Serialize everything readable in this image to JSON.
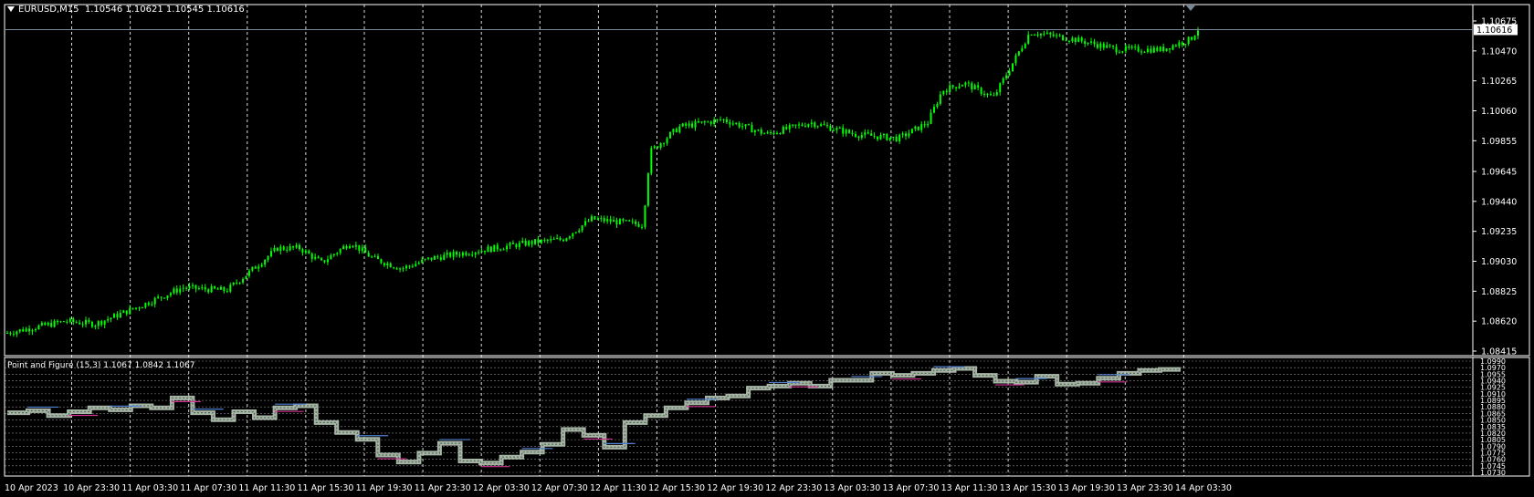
{
  "chart_title": {
    "symbol": "EURUSD,M15",
    "ohlc": "1.10546 1.10621 1.10545 1.10616"
  },
  "indicator_title": "Point and Figure (15,3) 1.1067 1.0842 1.1067",
  "current_price_label": "1.10616",
  "colors": {
    "background": "#000000",
    "candle": "#00ff00",
    "grid": "#ffffff",
    "frame": "#ffffff",
    "bid_line": "#778899",
    "pf_box": "#b8c8b8",
    "pf_blue": "#4f7fd0",
    "pf_magenta": "#d0308f",
    "price_label_bg": "#ffffff",
    "price_label_fg": "#000000"
  },
  "chart_data": [
    {
      "type": "candlestick",
      "y_ticks": [
        "1.10675",
        "1.10470",
        "1.10265",
        "1.10060",
        "1.09855",
        "1.09645",
        "1.09440",
        "1.09235",
        "1.09030",
        "1.08825",
        "1.08620",
        "1.08415"
      ],
      "ylim": [
        1.08415,
        1.10675
      ],
      "x_ticks": [
        "10 Apr 2023",
        "10 Apr 23:30",
        "11 Apr 03:30",
        "11 Apr 07:30",
        "11 Apr 11:30",
        "11 Apr 15:30",
        "11 Apr 19:30",
        "11 Apr 23:30",
        "12 Apr 03:30",
        "12 Apr 07:30",
        "12 Apr 11:30",
        "12 Apr 15:30",
        "12 Apr 19:30",
        "12 Apr 23:30",
        "13 Apr 03:30",
        "13 Apr 07:30",
        "13 Apr 11:30",
        "13 Apr 15:30",
        "13 Apr 19:30",
        "13 Apr 23:30",
        "14 Apr 03:30"
      ],
      "gridlines": "vertical-dashed",
      "close_path": [
        {
          "x": 0.0,
          "y": 1.0854
        },
        {
          "x": 0.04,
          "y": 1.0862
        },
        {
          "x": 0.06,
          "y": 1.086
        },
        {
          "x": 0.09,
          "y": 1.0872
        },
        {
          "x": 0.12,
          "y": 1.0885
        },
        {
          "x": 0.15,
          "y": 1.0883
        },
        {
          "x": 0.165,
          "y": 1.0895
        },
        {
          "x": 0.185,
          "y": 1.0912
        },
        {
          "x": 0.2,
          "y": 1.0912
        },
        {
          "x": 0.215,
          "y": 1.0902
        },
        {
          "x": 0.235,
          "y": 1.0916
        },
        {
          "x": 0.25,
          "y": 1.0905
        },
        {
          "x": 0.27,
          "y": 1.0898
        },
        {
          "x": 0.29,
          "y": 1.0905
        },
        {
          "x": 0.32,
          "y": 1.091
        },
        {
          "x": 0.36,
          "y": 1.0916
        },
        {
          "x": 0.38,
          "y": 1.0918
        },
        {
          "x": 0.4,
          "y": 1.0932
        },
        {
          "x": 0.435,
          "y": 1.0928
        },
        {
          "x": 0.44,
          "y": 1.0978
        },
        {
          "x": 0.46,
          "y": 1.0995
        },
        {
          "x": 0.49,
          "y": 1.1
        },
        {
          "x": 0.52,
          "y": 1.099
        },
        {
          "x": 0.55,
          "y": 1.0998
        },
        {
          "x": 0.58,
          "y": 1.099
        },
        {
          "x": 0.61,
          "y": 1.0987
        },
        {
          "x": 0.63,
          "y": 1.0998
        },
        {
          "x": 0.64,
          "y": 1.102
        },
        {
          "x": 0.655,
          "y": 1.1025
        },
        {
          "x": 0.675,
          "y": 1.1015
        },
        {
          "x": 0.69,
          "y": 1.1042
        },
        {
          "x": 0.7,
          "y": 1.106
        },
        {
          "x": 0.73,
          "y": 1.1055
        },
        {
          "x": 0.76,
          "y": 1.1048
        },
        {
          "x": 0.79,
          "y": 1.1048
        },
        {
          "x": 0.81,
          "y": 1.1055
        },
        {
          "x": 0.815,
          "y": 1.1062
        }
      ]
    },
    {
      "type": "point-and-figure",
      "params": "(15,3)",
      "y_ticks": [
        "1.0990",
        "1.0970",
        "1.0955",
        "1.0940",
        "1.0925",
        "1.0910",
        "1.0895",
        "1.0880",
        "1.0865",
        "1.0850",
        "1.0835",
        "1.0820",
        "1.0805",
        "1.0790",
        "1.0775",
        "1.0760",
        "1.0745",
        "1.0730"
      ],
      "ylim": [
        1.073,
        1.099
      ],
      "gridlines": "horizontal-dashed",
      "levels": [
        0.55,
        0.57,
        0.52,
        0.56,
        0.6,
        0.58,
        0.62,
        0.6,
        0.7,
        0.55,
        0.48,
        0.56,
        0.5,
        0.6,
        0.62,
        0.45,
        0.35,
        0.28,
        0.12,
        0.05,
        0.14,
        0.24,
        0.06,
        0.04,
        0.1,
        0.15,
        0.23,
        0.38,
        0.32,
        0.2,
        0.45,
        0.52,
        0.6,
        0.65,
        0.7,
        0.72,
        0.8,
        0.82,
        0.85,
        0.82,
        0.88,
        0.88,
        0.95,
        0.93,
        0.95,
        0.98,
        1.0,
        0.93,
        0.87,
        0.86,
        0.92,
        0.84,
        0.85,
        0.9,
        0.95,
        0.98,
        0.99
      ]
    }
  ]
}
